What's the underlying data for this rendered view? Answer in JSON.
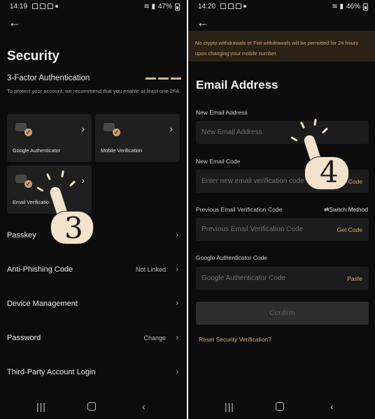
{
  "left": {
    "status": {
      "time": "14:19",
      "battery": "47%"
    },
    "title": "Security",
    "tfa": {
      "title": "3-Factor Authentication",
      "desc": "To protect your account, we recommend that you enable at least one 2FA.",
      "enabled_count": 3,
      "total": 3
    },
    "cards": [
      {
        "label": "Google Authenticator"
      },
      {
        "label": "Mobile Verification"
      },
      {
        "label": "Email Verificatio"
      }
    ],
    "rows": [
      {
        "label": "Passkey",
        "value": ""
      },
      {
        "label": "Anti-Phishing Code",
        "value": "Not Linked"
      },
      {
        "label": "Device Management",
        "value": ""
      },
      {
        "label": "Password",
        "value": "Change"
      },
      {
        "label": "Third-Party Account Login",
        "value": ""
      }
    ],
    "step_number": "3"
  },
  "right": {
    "status": {
      "time": "14:20",
      "battery": "46%"
    },
    "notice": "No crypto withdrawals or Fiat withdrawals will be permitted for 24 hours upon changing your mobile number.",
    "title": "Email Address",
    "fields": {
      "new_email": {
        "label": "New Email Address",
        "placeholder": "New Email Address"
      },
      "new_code": {
        "label": "New Email Code",
        "placeholder": "Enter new email verification code",
        "action": "Get Code"
      },
      "prev_code": {
        "label": "Previous Email Verification Code",
        "switch": "⇄Switch Method",
        "placeholder": "Previous Email Verification Code",
        "action": "Get Code"
      },
      "ga_code": {
        "label": "Google Authenticator Code",
        "placeholder": "Google Authenticator Code",
        "action": "Paste"
      }
    },
    "confirm": "Confirm",
    "reset": "Reset Security Verification?",
    "step_number": "4"
  },
  "colors": {
    "accent": "#d8ad72",
    "background": "#0c0c0c",
    "card": "#1f1f1f"
  },
  "icons": [
    "back-arrow-icon",
    "chevron-right-icon",
    "check-icon",
    "recents-icon",
    "home-icon",
    "back-nav-icon",
    "tap-hand-icon"
  ]
}
